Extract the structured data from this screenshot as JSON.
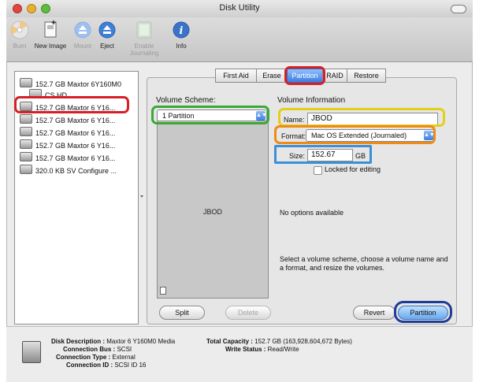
{
  "window": {
    "title": "Disk Utility"
  },
  "toolbar": {
    "items": [
      {
        "label": "Burn",
        "icon": "burn-icon",
        "enabled": false
      },
      {
        "label": "New Image",
        "icon": "new-image-icon",
        "enabled": true
      },
      {
        "label": "Mount",
        "icon": "mount-icon",
        "enabled": false
      },
      {
        "label": "Eject",
        "icon": "eject-icon",
        "enabled": true
      },
      {
        "label": "Enable Journaling",
        "icon": "journaling-icon",
        "enabled": false
      },
      {
        "label": "Info",
        "icon": "info-icon",
        "enabled": true
      }
    ]
  },
  "sidebar": {
    "items": [
      {
        "label": "152.7 GB Maxtor 6Y160M0",
        "type": "disk"
      },
      {
        "label": "CS HD",
        "type": "volume"
      },
      {
        "label": "152.7 GB Maxtor 6 Y16...",
        "type": "disk",
        "selected": true
      },
      {
        "label": "152.7 GB Maxtor 6 Y16...",
        "type": "disk"
      },
      {
        "label": "152.7 GB Maxtor 6 Y16...",
        "type": "disk"
      },
      {
        "label": "152.7 GB Maxtor 6 Y16...",
        "type": "disk"
      },
      {
        "label": "152.7 GB Maxtor 6 Y16...",
        "type": "disk"
      },
      {
        "label": "320.0 KB SV Configure ...",
        "type": "disk"
      }
    ]
  },
  "tabs": [
    {
      "label": "First Aid"
    },
    {
      "label": "Erase"
    },
    {
      "label": "Partition",
      "selected": true
    },
    {
      "label": "RAID"
    },
    {
      "label": "Restore"
    }
  ],
  "scheme": {
    "title": "Volume Scheme:",
    "selected": "1 Partition",
    "partition_label": "JBOD",
    "split_label": "Split",
    "delete_label": "Delete"
  },
  "info": {
    "title": "Volume Information",
    "name_label": "Name:",
    "name_value": "JBOD",
    "format_label": "Format:",
    "format_value": "Mac OS Extended (Journaled)",
    "size_label": "Size:",
    "size_value": "152.67",
    "size_unit": "GB",
    "locked_label": "Locked for editing",
    "no_options": "No options available",
    "help_text": "Select a volume scheme, choose a volume name and a format, and resize the volumes.",
    "revert_label": "Revert",
    "partition_button_label": "Partition"
  },
  "footer": {
    "disk_description_label": "Disk Description :",
    "disk_description_value": "Maxtor 6 Y160M0 Media",
    "connection_bus_label": "Connection Bus :",
    "connection_bus_value": "SCSI",
    "connection_type_label": "Connection Type :",
    "connection_type_value": "External",
    "connection_id_label": "Connection ID :",
    "connection_id_value": "SCSI ID 16",
    "total_capacity_label": "Total Capacity :",
    "total_capacity_value": "152.7 GB (163,928,604,672 Bytes)",
    "write_status_label": "Write Status :",
    "write_status_value": "Read/Write"
  },
  "highlight_colors": {
    "red": "#d61f26",
    "green": "#3aa935",
    "yellow": "#e3cf1a",
    "orange": "#ef8a17",
    "blue": "#3c8fd6",
    "navy": "#1f3c99"
  }
}
